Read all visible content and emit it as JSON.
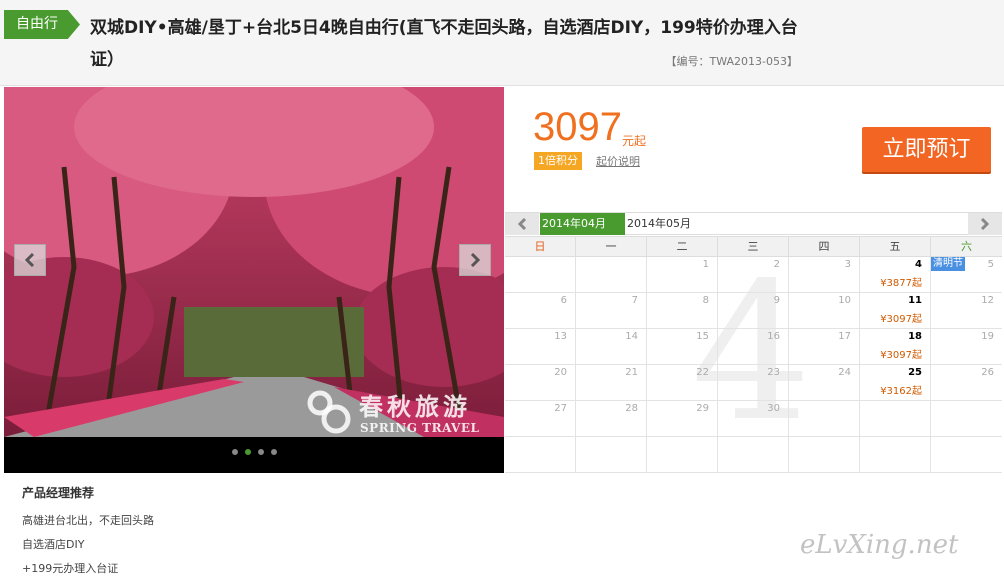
{
  "header": {
    "tag": "自由行",
    "title": "双城DIY•高雄/垦丁+台北5日4晚自由行(直飞不走回头路，自选酒店DIY，199特价办理入台证）",
    "code": "【编号：TWA2013-053】"
  },
  "gallery": {
    "watermark_cn": "春秋旅游",
    "watermark_en": "SPRING TRAVEL",
    "dots_count": 4,
    "active_dot": 2
  },
  "price": {
    "amount": "3097",
    "unit": "元起",
    "points": "1倍积分",
    "explain": "起价说明",
    "book_label": "立即预订"
  },
  "calendar": {
    "months": [
      "2014年04月",
      "2014年05月"
    ],
    "weekdays": [
      "日",
      "一",
      "二",
      "三",
      "四",
      "五",
      "六"
    ],
    "big_month": "4",
    "cells": [
      {
        "d": ""
      },
      {
        "d": "",
        "x": true
      },
      {
        "d": "1"
      },
      {
        "d": "2"
      },
      {
        "d": "3"
      },
      {
        "d": "4",
        "p": "¥3877起"
      },
      {
        "d": "5",
        "hol": "清明节"
      },
      {
        "d": "6"
      },
      {
        "d": "7"
      },
      {
        "d": "8"
      },
      {
        "d": "9"
      },
      {
        "d": "10"
      },
      {
        "d": "11",
        "p": "¥3097起"
      },
      {
        "d": "12"
      },
      {
        "d": "13"
      },
      {
        "d": "14"
      },
      {
        "d": "15"
      },
      {
        "d": "16"
      },
      {
        "d": "17"
      },
      {
        "d": "18",
        "p": "¥3097起"
      },
      {
        "d": "19"
      },
      {
        "d": "20"
      },
      {
        "d": "21"
      },
      {
        "d": "22"
      },
      {
        "d": "23"
      },
      {
        "d": "24"
      },
      {
        "d": "25",
        "p": "¥3162起"
      },
      {
        "d": "26"
      },
      {
        "d": "27"
      },
      {
        "d": "28"
      },
      {
        "d": "29"
      },
      {
        "d": "30"
      },
      {
        "d": ""
      },
      {
        "d": ""
      },
      {
        "d": ""
      },
      {
        "d": ""
      },
      {
        "d": ""
      },
      {
        "d": ""
      },
      {
        "d": ""
      },
      {
        "d": ""
      },
      {
        "d": ""
      },
      {
        "d": ""
      }
    ]
  },
  "recommend": {
    "heading": "产品经理推荐",
    "items": [
      "高雄进台北出，不走回头路",
      "自选酒店DIY",
      "+199元办理入台证"
    ]
  },
  "site_watermark": "eLvXing.net"
}
